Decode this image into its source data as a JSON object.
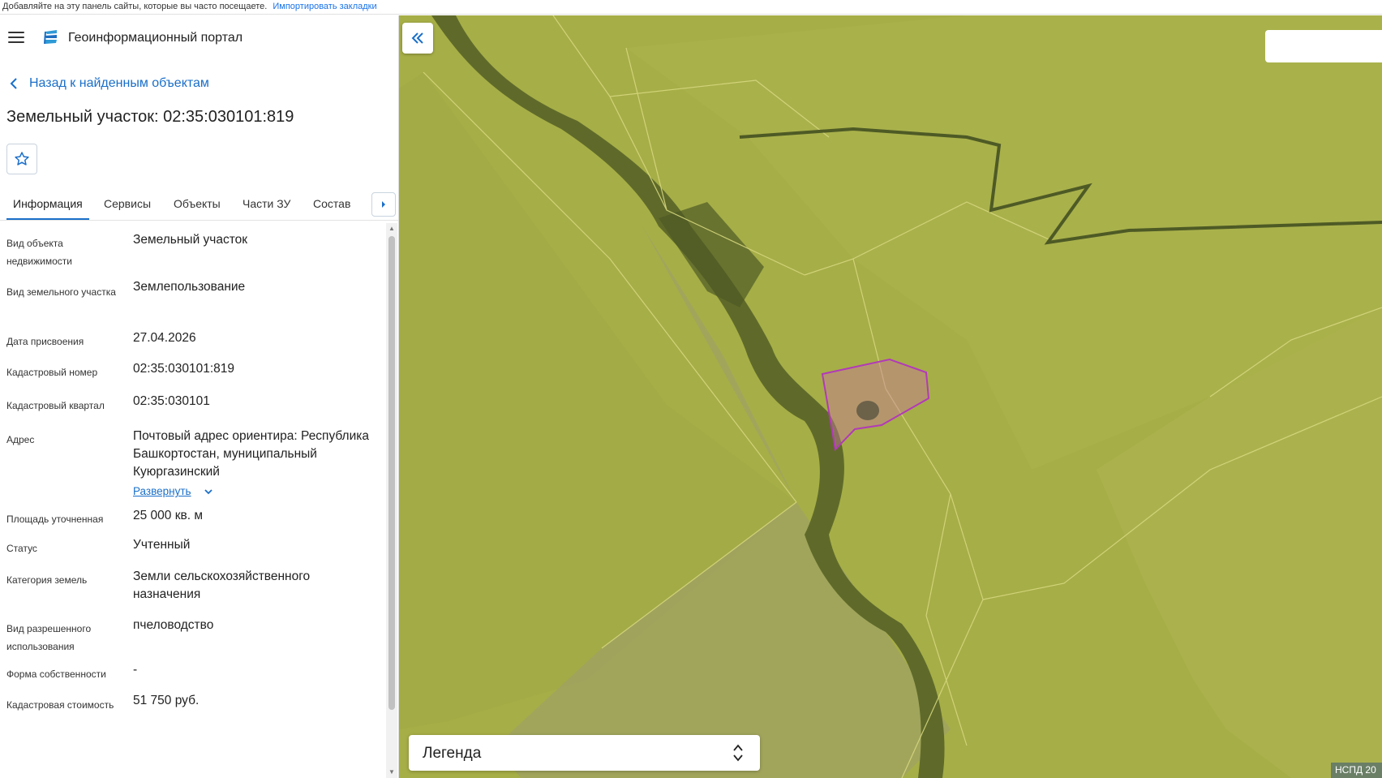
{
  "bookmarks_bar": {
    "text": "Добавляйте на эту панель сайты, которые вы часто посещаете.",
    "import_link": "Импортировать закладки"
  },
  "header": {
    "menu_icon": "hamburger-menu-icon",
    "logo_icon": "portal-logo-icon",
    "title": "Геоинформационный портал"
  },
  "back_link": "Назад к найденным объектам",
  "object_title": "Земельный участок: 02:35:030101:819",
  "favorite_icon": "star-outline-icon",
  "tabs": [
    {
      "label": "Информация",
      "active": true
    },
    {
      "label": "Сервисы",
      "active": false
    },
    {
      "label": "Объекты",
      "active": false
    },
    {
      "label": "Части ЗУ",
      "active": false
    },
    {
      "label": "Состав",
      "active": false
    }
  ],
  "properties": [
    {
      "label": "Вид объекта недвижимости",
      "value": "Земельный участок"
    },
    {
      "label": "Вид земельного участка",
      "value": "Землепользование"
    },
    {
      "label": "Дата присвоения",
      "value": "27.04.2026"
    },
    {
      "label": "Кадастровый номер",
      "value": "02:35:030101:819"
    },
    {
      "label": "Кадастровый квартал",
      "value": "02:35:030101"
    },
    {
      "label": "Адрес",
      "value": "Почтовый адрес ориентира: Республика Башкортостан, муниципальный Куюргазинский",
      "expand_label": "Развернуть"
    },
    {
      "label": "Площадь уточненная",
      "value": "25 000 кв. м"
    },
    {
      "label": "Статус",
      "value": "Учтенный"
    },
    {
      "label": "Категория земель",
      "value": "Земли сельскохозяйственного назначения"
    },
    {
      "label": "Вид разрешенного использования",
      "value": "пчеловодство"
    },
    {
      "label": "Форма собственности",
      "value": "-"
    },
    {
      "label": "Кадастровая стоимость",
      "value": "51 750 руб."
    }
  ],
  "map": {
    "legend_label": "Легенда",
    "attribution": "НСПД 20",
    "parcel_outline_color": "#b23ab8",
    "field_color": "#a9b04a",
    "boundary_color": "#d8d880"
  }
}
